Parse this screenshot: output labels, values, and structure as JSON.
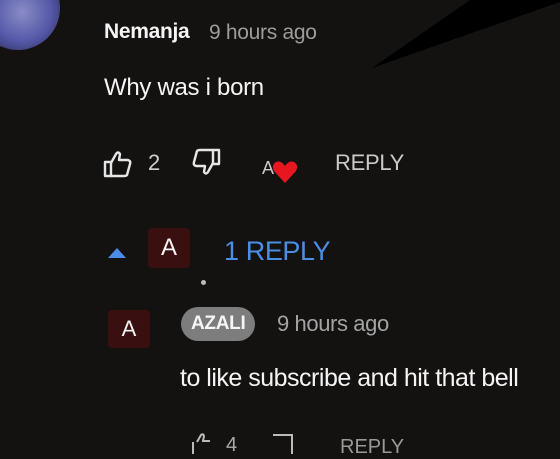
{
  "comment": {
    "author": "Nemanja",
    "timestamp": "9 hours ago",
    "text": "Why was i born",
    "like_count": "2",
    "creator_heart_avatar_letter": "A",
    "reply_label": "REPLY",
    "replies_toggle": "1 REPLY",
    "reply_avatar_letter": "A"
  },
  "reply": {
    "avatar_letter": "A",
    "author": "AZALI",
    "timestamp": "9 hours ago",
    "text": "to like subscribe and hit that bell",
    "like_count": "4",
    "reply_label": "REPLY"
  },
  "colors": {
    "background": "#141211",
    "link_blue": "#4a8ee6",
    "heart_red": "#e8161e",
    "avatar_bg": "#3a0f10",
    "author_badge_bg": "#7d7d7d"
  },
  "icons": [
    "thumbs-up-icon",
    "thumbs-down-icon",
    "heart-icon",
    "caret-up-icon"
  ]
}
